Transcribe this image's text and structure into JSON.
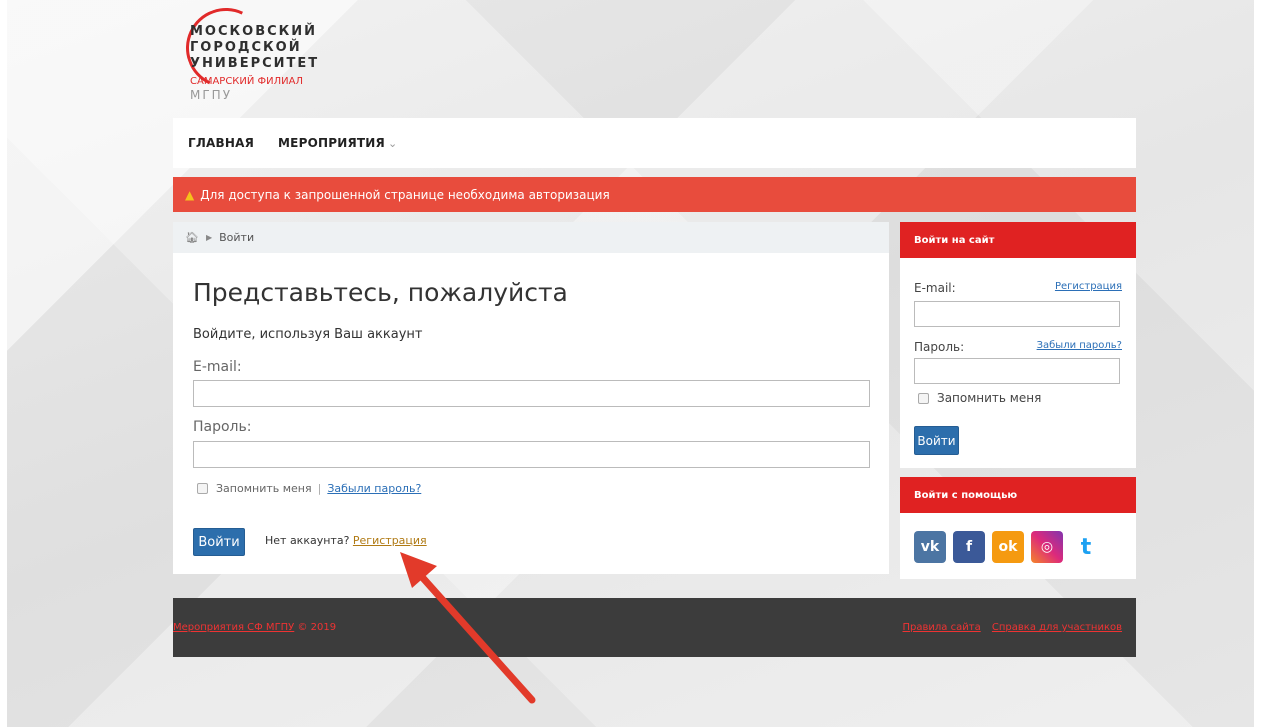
{
  "logo": {
    "line1": "МОСКОВСКИЙ",
    "line2": "ГОРОДСКОЙ",
    "line3": "УНИВЕРСИТЕТ",
    "sub": "САМАРСКИЙ ФИЛИАЛ",
    "abbr": "МГПУ"
  },
  "nav": {
    "items": [
      {
        "label": "ГЛАВНАЯ"
      },
      {
        "label": "МЕРОПРИЯТИЯ"
      }
    ]
  },
  "alert": {
    "text": "Для доступа к запрошенной странице необходима авторизация"
  },
  "breadcrumb": {
    "current": "Войти"
  },
  "main": {
    "title": "Представьтесь, пожалуйста",
    "subtitle": "Войдите, используя Ваш аккаунт",
    "email_label": "E-mail:",
    "email_value": "",
    "password_label": "Пароль:",
    "password_value": "",
    "remember_label": "Запомнить меня",
    "forgot_label": "Забыли пароль?",
    "login_button": "Войти",
    "no_account": "Нет аккаунта?",
    "register_link": "Регистрация"
  },
  "side_login": {
    "header": "Войти на сайт",
    "email_label": "E-mail:",
    "register_link": "Регистрация",
    "password_label": "Пароль:",
    "forgot_link": "Забыли пароль?",
    "remember_label": "Запомнить меня",
    "login_button": "Войти"
  },
  "side_social": {
    "header": "Войти с помощью",
    "items": [
      {
        "icon": "vk-icon",
        "glyph": "vk",
        "color": "#4c75a3"
      },
      {
        "icon": "facebook-icon",
        "glyph": "f",
        "color": "#3b5998"
      },
      {
        "icon": "odnoklassniki-icon",
        "glyph": "ok",
        "color": "#f59a10"
      },
      {
        "icon": "instagram-icon",
        "glyph": "◎",
        "color": "#c32aa3"
      },
      {
        "icon": "twitter-icon",
        "glyph": "t",
        "color": "#1da1f2"
      }
    ]
  },
  "footer": {
    "left_link": "Мероприятия СФ МГПУ",
    "copyright": "© 2019",
    "rules_link": "Правила сайта",
    "help_link": "Справка для участников"
  },
  "colors": {
    "accent_red": "#e02222",
    "alert_red": "#e84c3d",
    "button_blue": "#2c6eac",
    "footer_bg": "#3c3c3c"
  }
}
